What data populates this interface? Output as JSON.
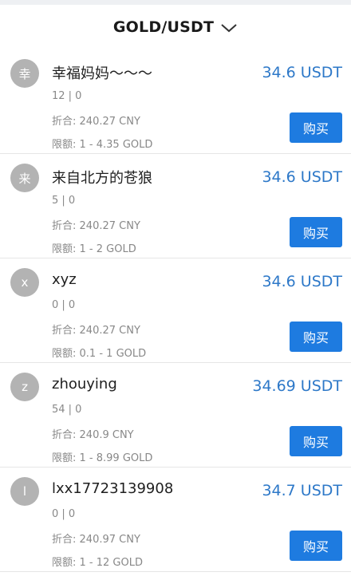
{
  "header": {
    "pair_label": "GOLD/USDT",
    "dropdown_icon": "chevron-down-icon"
  },
  "labels": {
    "equiv_prefix": "折合:",
    "limit_prefix": "限额:",
    "buy_label": "购买"
  },
  "colors": {
    "price": "#2d78c8",
    "buy_button": "#1e7be0",
    "avatar_bg": "#b3b3b3"
  },
  "offers": [
    {
      "avatar": "幸",
      "name": "幸福妈妈～～～",
      "stats": "12 | 0",
      "equiv": "240.27 CNY",
      "limit": "1 - 4.35 GOLD",
      "price": "34.6 USDT"
    },
    {
      "avatar": "来",
      "name": "来自北方的苍狼",
      "stats": "5 | 0",
      "equiv": "240.27 CNY",
      "limit": "1 - 2 GOLD",
      "price": "34.6 USDT"
    },
    {
      "avatar": "x",
      "name": "xyz",
      "stats": "0 | 0",
      "equiv": "240.27 CNY",
      "limit": "0.1 - 1 GOLD",
      "price": "34.6 USDT"
    },
    {
      "avatar": "z",
      "name": "zhouying",
      "stats": "54 | 0",
      "equiv": "240.9 CNY",
      "limit": "1 - 8.99 GOLD",
      "price": "34.69 USDT"
    },
    {
      "avatar": "l",
      "name": "lxx17723139908",
      "stats": "0 | 0",
      "equiv": "240.97 CNY",
      "limit": "1 - 12 GOLD",
      "price": "34.7 USDT"
    }
  ]
}
